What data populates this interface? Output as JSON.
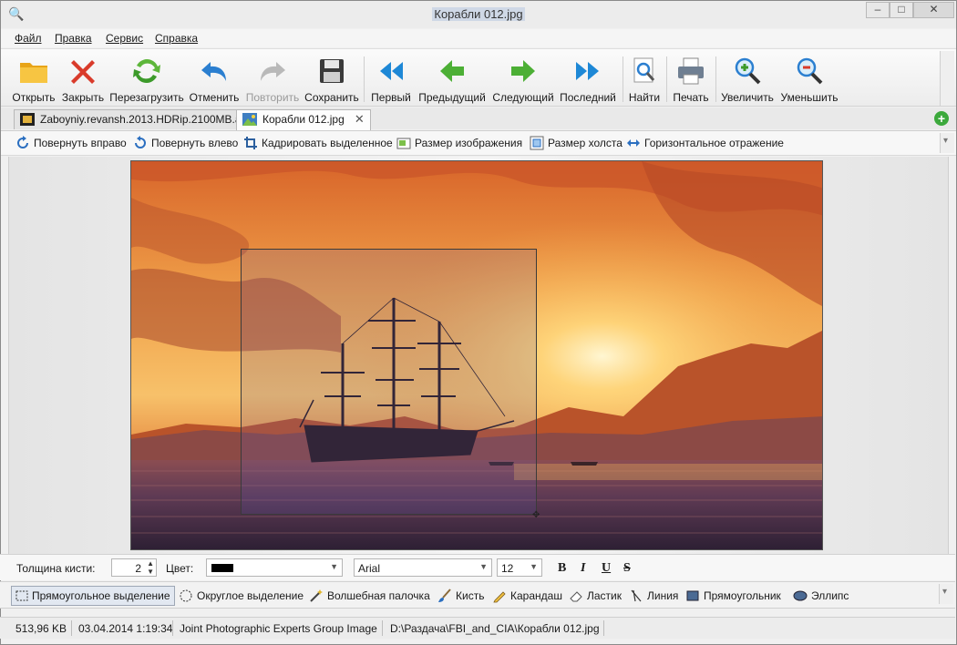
{
  "window": {
    "title": "Корабли 012.jpg"
  },
  "menu": [
    "Файл",
    "Правка",
    "Сервис",
    "Справка"
  ],
  "toolbar": [
    {
      "label": "Открыть",
      "icon": "folder-icon"
    },
    {
      "label": "Закрыть",
      "icon": "red-x-icon"
    },
    {
      "label": "Перезагрузить",
      "icon": "reload-icon"
    },
    {
      "label": "Отменить",
      "icon": "undo-icon"
    },
    {
      "label": "Повторить",
      "icon": "redo-icon",
      "disabled": true
    },
    {
      "label": "Сохранить",
      "icon": "floppy-icon"
    },
    {
      "label": "Первый",
      "icon": "first-icon"
    },
    {
      "label": "Предыдущий",
      "icon": "previous-icon"
    },
    {
      "label": "Следующий",
      "icon": "next-icon"
    },
    {
      "label": "Последний",
      "icon": "last-icon"
    },
    {
      "label": "Найти",
      "icon": "find-icon"
    },
    {
      "label": "Печать",
      "icon": "printer-icon"
    },
    {
      "label": "Увеличить",
      "icon": "zoom-in-icon"
    },
    {
      "label": "Уменьшить",
      "icon": "zoom-out-icon"
    }
  ],
  "tabs": [
    {
      "label": "Zaboyniy.revansh.2013.HDRip.2100MB.avi",
      "active": false
    },
    {
      "label": "Корабли 012.jpg",
      "active": true
    }
  ],
  "edit_toolbar": [
    "Повернуть вправо",
    "Повернуть влево",
    "Кадрировать выделенное",
    "Размер изображения",
    "Размер холста",
    "Горизонтальное отражение"
  ],
  "brush": {
    "thickness_label": "Толщина кисти:",
    "thickness_value": "2",
    "color_label": "Цвет:",
    "color": "#000000",
    "font": "Arial",
    "font_size": "12",
    "format": [
      "B",
      "I",
      "U",
      "S"
    ]
  },
  "tools": [
    "Прямоугольное выделение",
    "Округлое выделение",
    "Волшебная палочка",
    "Кисть",
    "Карандаш",
    "Ластик",
    "Линия",
    "Прямоугольник",
    "Эллипс"
  ],
  "status": {
    "size": "513,96 KB",
    "date": "03.04.2014 1:19:34",
    "type": "Joint Photographic Experts Group Image",
    "path": "D:\\Раздача\\FBI_and_CIA\\Корабли 012.jpg"
  },
  "colors": {
    "accent_green": "#3ca93c",
    "accent_blue": "#1e88d6",
    "close_red": "#d93b2b"
  }
}
